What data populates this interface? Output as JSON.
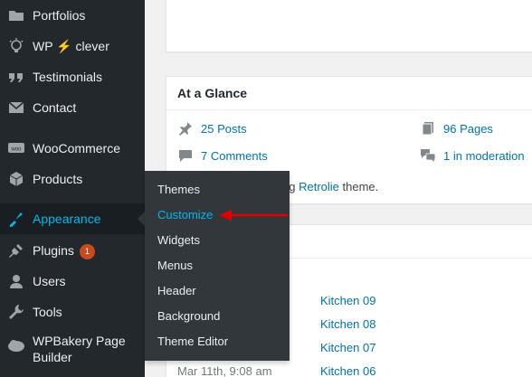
{
  "sidebar": {
    "items": [
      {
        "label": "Portfolios",
        "icon": "portfolio-icon"
      },
      {
        "label": "WP",
        "label2": "clever",
        "icon": "lightbulb-icon"
      },
      {
        "label": "Testimonials",
        "icon": "quote-icon"
      },
      {
        "label": "Contact",
        "icon": "envelope-icon"
      },
      {
        "label": "WooCommerce",
        "icon": "woocommerce-icon"
      },
      {
        "label": "Products",
        "icon": "box-icon"
      },
      {
        "label": "Appearance",
        "icon": "paintbrush-icon"
      },
      {
        "label": "Plugins",
        "icon": "plug-icon",
        "badge": "1"
      },
      {
        "label": "Users",
        "icon": "user-icon"
      },
      {
        "label": "Tools",
        "icon": "wrench-icon"
      },
      {
        "label": "WPBakery Page",
        "label2": "Builder",
        "icon": "wpbakery-icon"
      }
    ]
  },
  "submenu": {
    "items": [
      "Themes",
      "Customize",
      "Widgets",
      "Menus",
      "Header",
      "Background",
      "Theme Editor"
    ]
  },
  "glance": {
    "title": "At a Glance",
    "posts": "25 Posts",
    "pages": "96 Pages",
    "comments": "7 Comments",
    "moderation": "1 in moderation",
    "theme_prefix": "ng",
    "theme_name": "Retrolie",
    "theme_suffix": "theme."
  },
  "activity": {
    "links": [
      "Kitchen 09",
      "Kitchen 08",
      "Kitchen 07",
      "Kitchen 06"
    ],
    "date": "Mar 11th, 9:08 am"
  },
  "colors": {
    "sidebar_bg": "#23282d",
    "accent": "#0073aa",
    "current": "#00b9eb",
    "annotation": "#e00000"
  }
}
